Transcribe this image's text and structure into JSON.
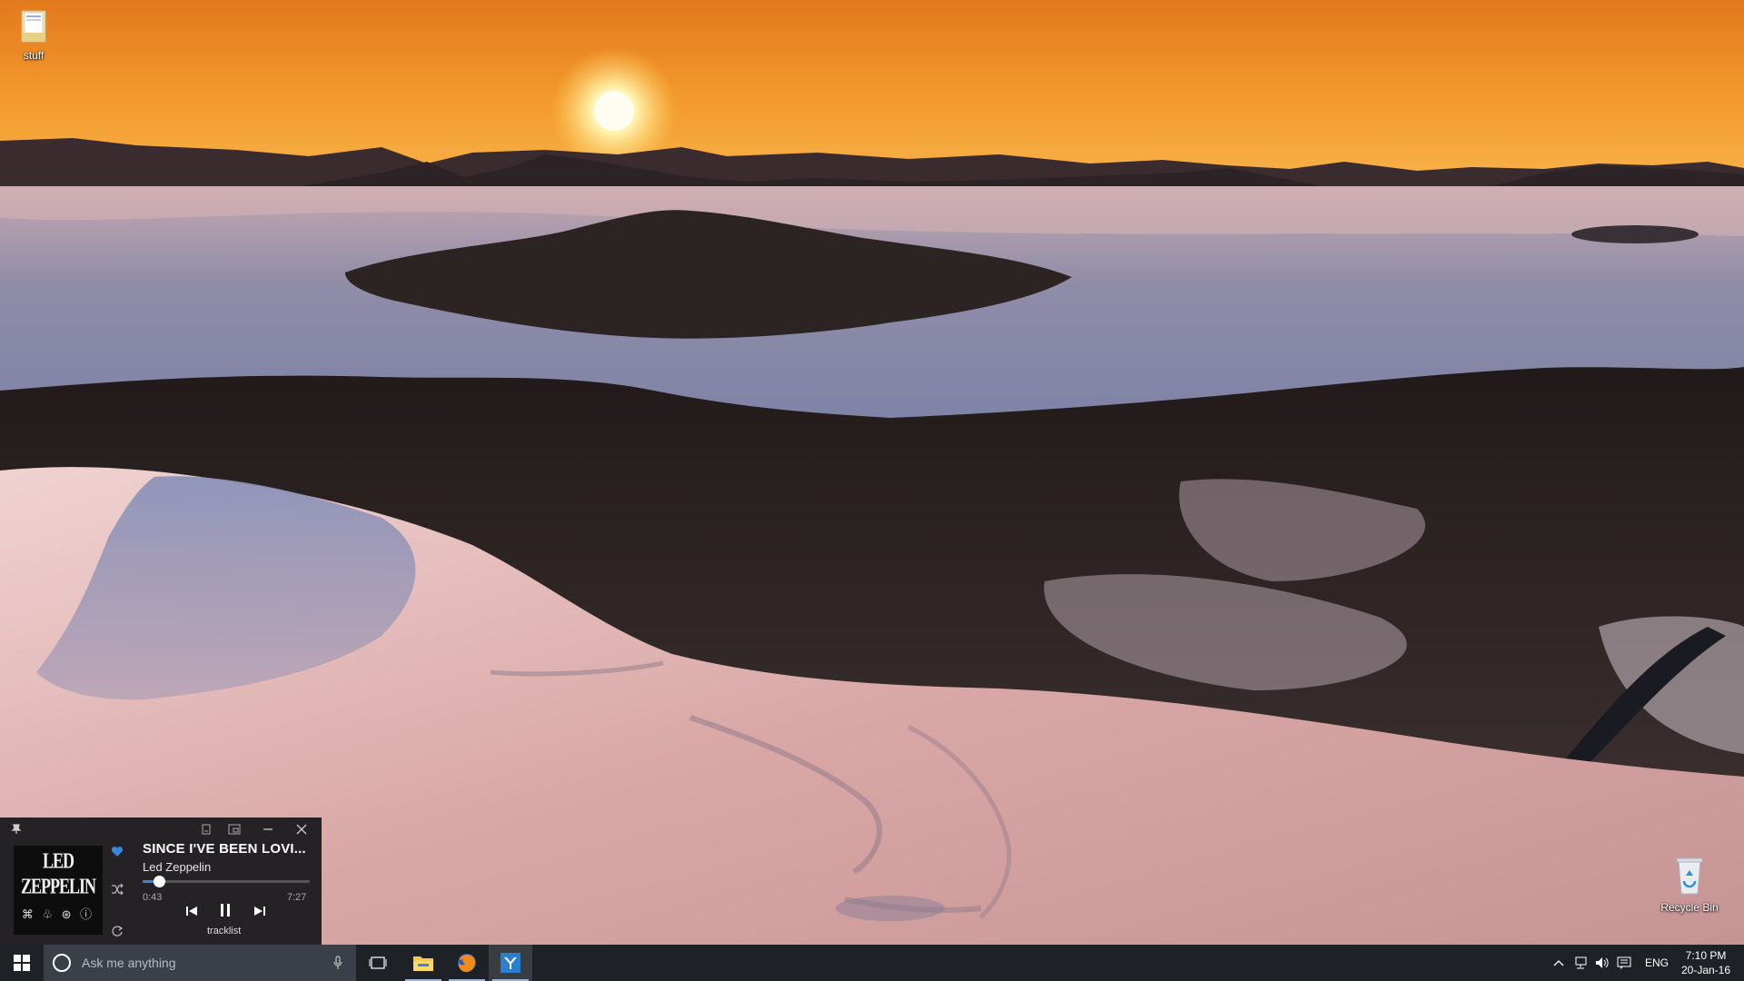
{
  "desktop": {
    "icons": [
      {
        "label": "stuff",
        "icon": "folder-icon"
      },
      {
        "label": "Recycle Bin",
        "icon": "recycle-bin-icon"
      }
    ]
  },
  "player": {
    "album_art_text": "LED ZEPPELIN",
    "track_title": "SINCE I'VE BEEN LOVI...",
    "artist": "Led Zeppelin",
    "elapsed": "0:43",
    "total": "7:27",
    "progress_fraction": 0.096,
    "tracklist_label": "tracklist",
    "favorite": true,
    "accent_color": "#3a86d8"
  },
  "taskbar": {
    "search_placeholder": "Ask me anything",
    "apps": [
      "task-view-icon",
      "file-explorer-icon",
      "firefox-icon",
      "music-player-icon"
    ],
    "language": "ENG",
    "time": "7:10 PM",
    "date": "20-Jan-16"
  }
}
